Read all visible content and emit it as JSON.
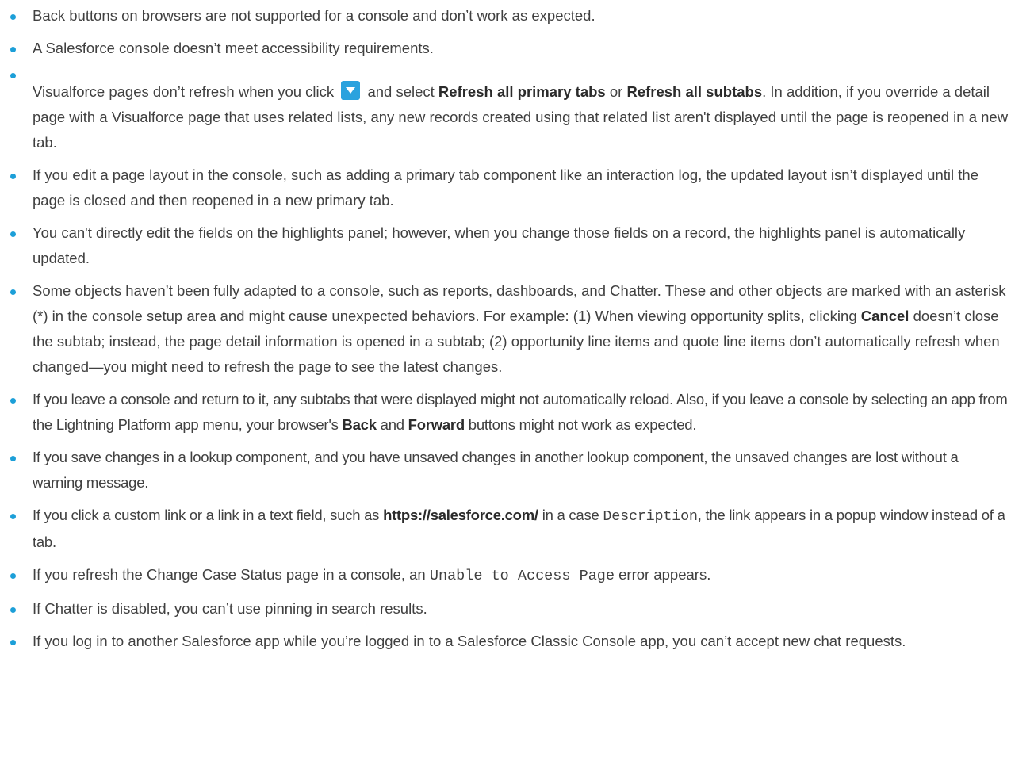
{
  "accent_color": "#1c9fd8",
  "icon_color": "#2aa2de",
  "bullets": [
    {
      "text": "Back buttons on browsers are not supported for a console and don’t work as expected."
    },
    {
      "text": "A Salesforce console doesn’t meet accessibility requirements."
    },
    {
      "part1": "Visualforce pages don’t refresh when you click",
      "icon": "dropdown-arrow-icon",
      "part2": "and select",
      "bold1": "Refresh all primary tabs",
      "part3": "or",
      "bold2": "Refresh all subtabs",
      "part4": ". In addition, if you override a detail page with a Visualforce page that uses related lists, any new records created using that related list aren't displayed until the page is reopened in a new tab."
    },
    {
      "text": "If you edit a page layout in the console, such as adding a primary tab component like an interaction log, the updated layout isn’t displayed until the page is closed and then reopened in a new primary tab."
    },
    {
      "text": "You can't directly edit the fields on the highlights panel; however, when you change those fields on a record, the highlights panel is automatically updated."
    },
    {
      "part1": "Some objects haven’t been fully adapted to a console, such as reports, dashboards, and Chatter. These and other objects are marked with an asterisk (*) in the console setup area and might cause unexpected behaviors. For example: (1) When viewing opportunity splits, clicking",
      "bold1": "Cancel",
      "part2": "doesn’t close the subtab; instead, the page detail information is opened in a subtab; (2) opportunity line items and quote line items don’t automatically refresh when changed—you might need to refresh the page to see the latest changes."
    },
    {
      "part1": "If you leave a console and return to it, any subtabs that were displayed might not automatically reload. Also, if you leave a console by selecting an app from the Lightning Platform app menu, your browser's",
      "bold1": "Back",
      "part2": "and",
      "bold2": "Forward",
      "part3": "buttons might not work as expected."
    },
    {
      "text": "If you save changes in a lookup component, and you have unsaved changes in another lookup component, the unsaved changes are lost without a warning message."
    },
    {
      "part1": "If you click a custom link or a link in a text field, such as",
      "bold1": "https://salesforce.com/",
      "part2": "in a case",
      "code1": "Description",
      "part3": ", the link appears in a popup window instead of a tab."
    },
    {
      "part1": "If you refresh the Change Case Status page in a console, an",
      "code1": "Unable to Access Page",
      "part2": "error appears."
    },
    {
      "text": "If Chatter is disabled, you can’t use pinning in search results."
    },
    {
      "text": "If you log in to another Salesforce app while you’re logged in to a Salesforce Classic Console app, you can’t accept new chat requests."
    }
  ]
}
